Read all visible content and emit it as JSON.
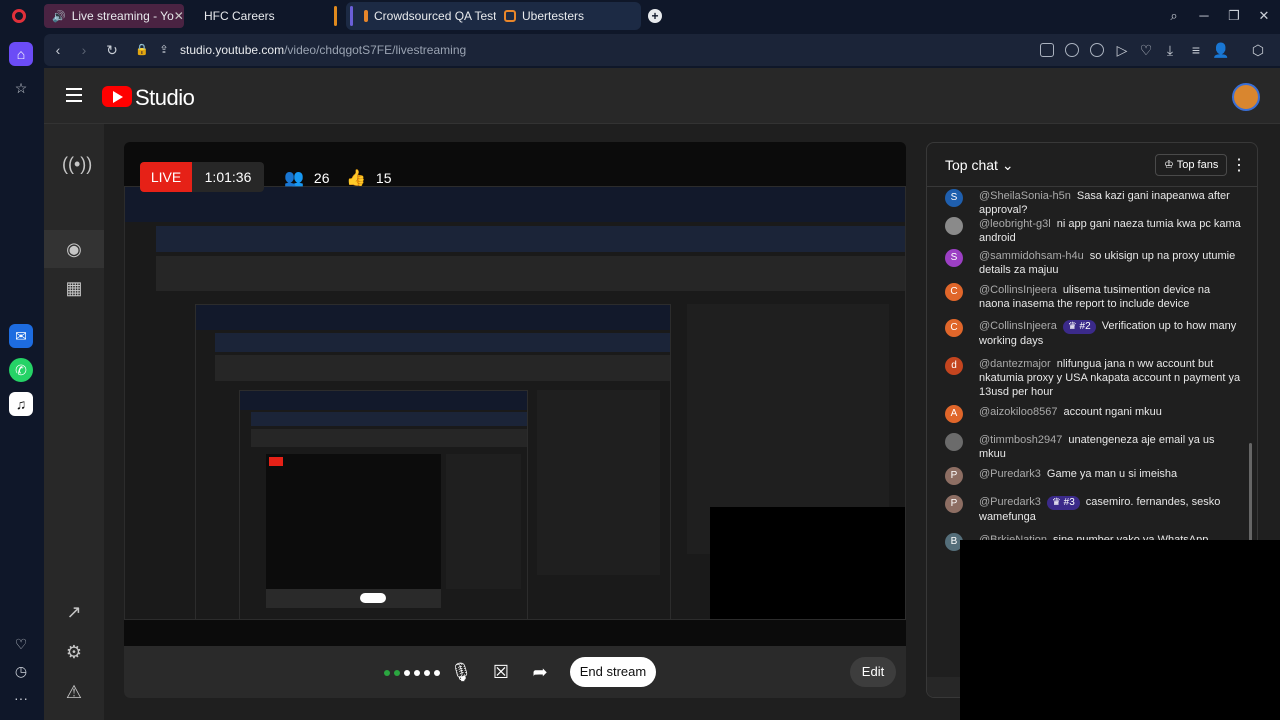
{
  "browser": {
    "tabs": [
      {
        "label": "Live streaming - Yo",
        "active": true
      },
      {
        "label": "HFC Careers"
      },
      {
        "label": "Crowdsourced QA Testing"
      },
      {
        "label": "Ubertesters"
      }
    ],
    "url_host": "studio.youtube.com",
    "url_path": "/video/chdqgotS7FE/livestreaming"
  },
  "studio": {
    "title": "Studio",
    "stream": {
      "live_label": "LIVE",
      "elapsed": "1:01:36",
      "viewers": "26",
      "likes": "15"
    },
    "controls": {
      "end_stream": "End stream",
      "edit": "Edit"
    },
    "chat": {
      "title": "Top chat",
      "top_fans": "Top fans",
      "messages": [
        {
          "initial": "S",
          "color": "#1f5fae",
          "author": "@SheilaSonia-h5n",
          "text": "Sasa kazi gani inapeanwa after approval?"
        },
        {
          "initial": "",
          "color": "#8a8a8a",
          "author": "@leobright-g3l",
          "text": "ni app gani naeza tumia kwa pc kama android"
        },
        {
          "initial": "S",
          "color": "#9c3fc4",
          "author": "@sammidohsam-h4u",
          "text": "so ukisign up na proxy utumie details za majuu"
        },
        {
          "initial": "C",
          "color": "#e0662a",
          "author": "@CollinsInjeera",
          "text": "ulisema tusimention device na naona inasema the report to include device"
        },
        {
          "initial": "C",
          "color": "#e0662a",
          "author": "@CollinsInjeera",
          "badge": "#2",
          "text": "Verification up to how many working days"
        },
        {
          "initial": "d",
          "color": "#c4451f",
          "author": "@dantezmajor",
          "text": "nlifungua jana n ww account but nkatumia proxy y USA nkapata account n payment ya 13usd per hour"
        },
        {
          "initial": "A",
          "color": "#e0662a",
          "author": "@aizokiloo8567",
          "text": "account ngani mkuu"
        },
        {
          "initial": "",
          "color": "#6b6b6b",
          "author": "@timmbosh2947",
          "text": "unatengeneza aje email ya us mkuu"
        },
        {
          "initial": "P",
          "color": "#8d6e63",
          "author": "@Puredark3",
          "text": "Game ya man u si imeisha"
        },
        {
          "initial": "P",
          "color": "#8d6e63",
          "author": "@Puredark3",
          "badge": "#3",
          "text": "casemiro. fernandes, sesko wamefunga"
        },
        {
          "initial": "B",
          "color": "#546e7a",
          "author": "@BrkieNation",
          "text": "sine number yako ya WhatsApp"
        }
      ]
    }
  }
}
